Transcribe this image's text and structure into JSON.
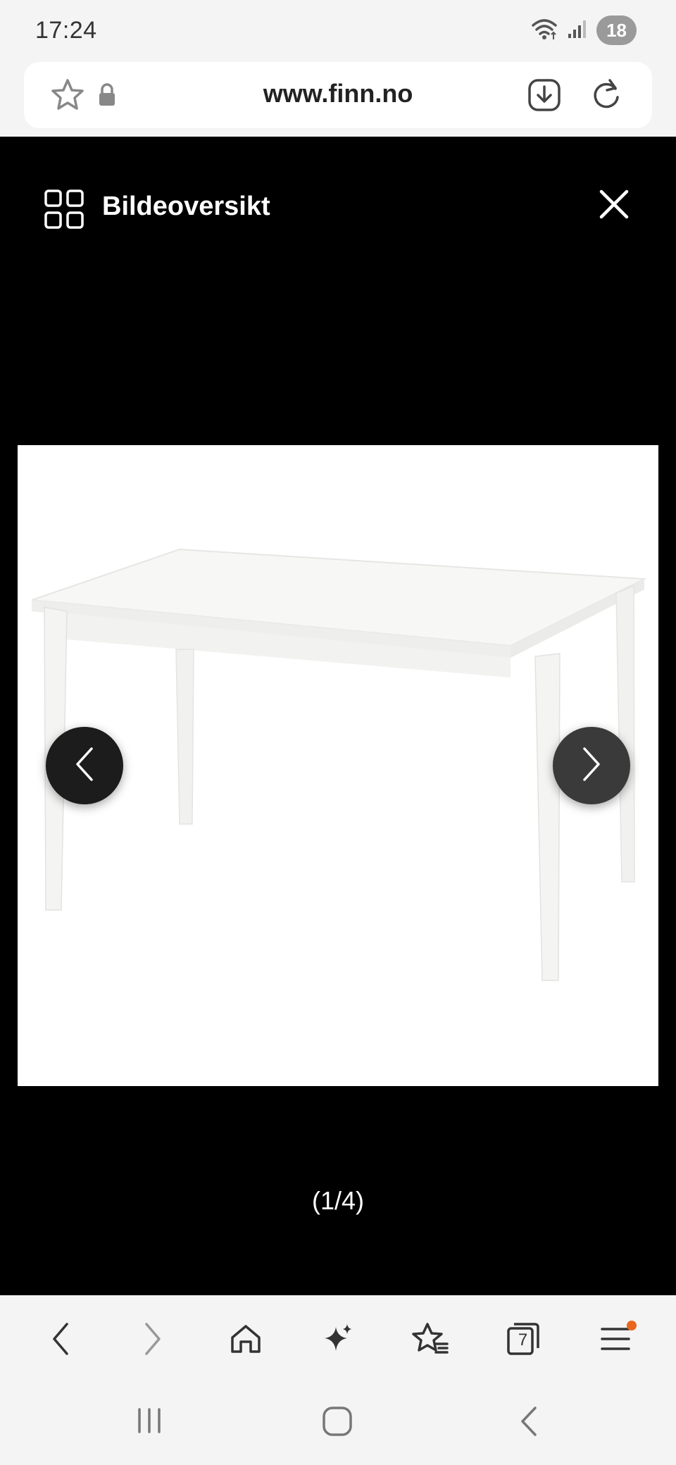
{
  "status": {
    "time": "17:24",
    "battery": "18",
    "icons": [
      "wifi-icon",
      "signal-icon",
      "battery-icon"
    ]
  },
  "url_bar": {
    "url": "www.finn.no",
    "icons": [
      "star-icon",
      "lock-icon",
      "download-icon",
      "reload-icon"
    ]
  },
  "viewer": {
    "title": "Bildeoversikt",
    "counter": "(1/4)",
    "current_image": 1,
    "total_images": 4,
    "icons": [
      "grid-icon",
      "close-icon",
      "chevron-left-icon",
      "chevron-right-icon"
    ]
  },
  "toolbar": {
    "items": [
      {
        "name": "back",
        "icon": "chevron-left-icon"
      },
      {
        "name": "forward",
        "icon": "chevron-right-icon"
      },
      {
        "name": "home",
        "icon": "home-icon"
      },
      {
        "name": "ai",
        "icon": "sparkle-icon"
      },
      {
        "name": "bookmarks",
        "icon": "bookmark-star-icon"
      },
      {
        "name": "tabs",
        "icon": "tabs-icon",
        "count": "7"
      },
      {
        "name": "menu",
        "icon": "menu-icon"
      }
    ]
  },
  "colors": {
    "viewer_bg": "#000000",
    "chrome_bg": "#f4f4f4",
    "notification_dot": "#e8661e"
  }
}
